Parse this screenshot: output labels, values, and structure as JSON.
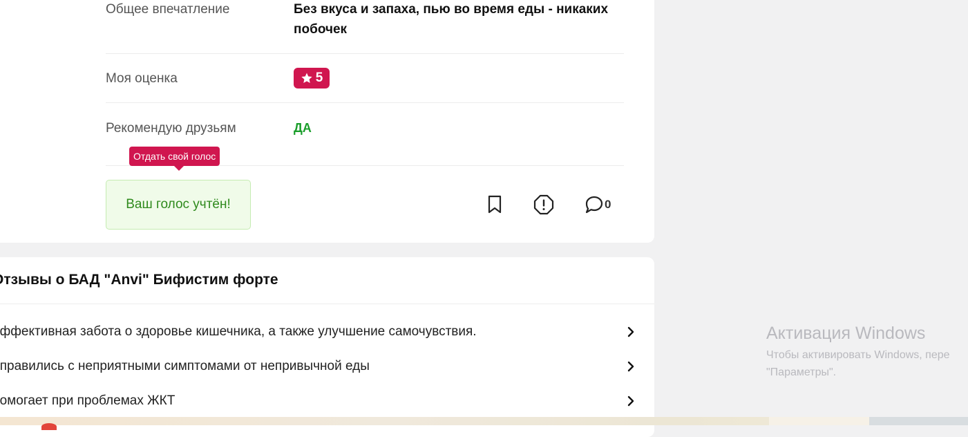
{
  "review_card": {
    "rows": [
      {
        "label": "Общее впечатление",
        "value_line1": "Без вкуса и запаха, пью во время еды - никаких",
        "value_line2": "побочек"
      },
      {
        "label": "Моя оценка",
        "rating": "5"
      },
      {
        "label": "Рекомендую друзьям",
        "value": "ДА"
      }
    ],
    "tooltip": "Отдать свой голос",
    "vote_status": "Ваш голос учтён!",
    "comment_count": "0",
    "colors": {
      "accent": "#d0164f",
      "success": "#1a9e2b",
      "vote_bg": "#f0fbe9"
    },
    "icons": [
      "bookmark-icon",
      "report-icon",
      "comment-icon"
    ]
  },
  "reviews_section": {
    "title": "Отзывы о БАД \"Anvi\" Бифистим форте",
    "items": [
      "Эффективная забота о здоровье кишечника, а также улучшение самочувствия.",
      "Справились с неприятными симптомами от непривычной еды",
      "Помогает при проблемах ЖКТ"
    ]
  },
  "windows_activation": {
    "title": "Активация Windows",
    "line1": "Чтобы активировать Windows, пере",
    "line2": "\"Параметры\"."
  }
}
